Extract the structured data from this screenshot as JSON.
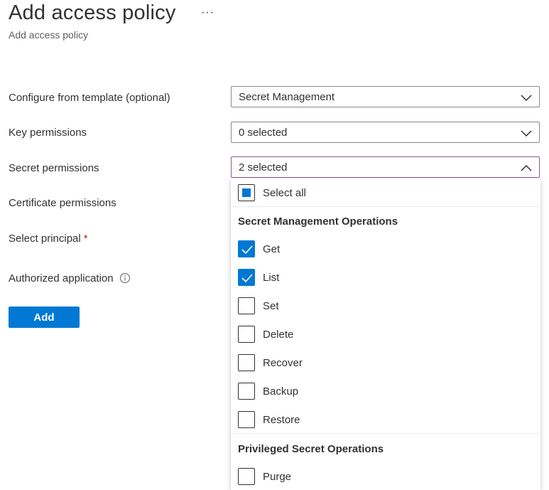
{
  "header": {
    "title": "Add access policy",
    "more_label": "···",
    "subtitle": "Add access policy"
  },
  "form": {
    "template": {
      "label": "Configure from template (optional)",
      "value": "Secret Management"
    },
    "key_permissions": {
      "label": "Key permissions",
      "value": "0 selected"
    },
    "secret_permissions": {
      "label": "Secret permissions",
      "value": "2 selected"
    },
    "certificate_permissions": {
      "label": "Certificate permissions"
    },
    "select_principal": {
      "label": "Select principal",
      "required_marker": "*"
    },
    "authorized_application": {
      "label": "Authorized application"
    },
    "add_button": "Add"
  },
  "dropdown": {
    "select_all": {
      "label": "Select all",
      "state": "indeterminate"
    },
    "groups": [
      {
        "header": "Secret Management Operations",
        "options": [
          {
            "label": "Get",
            "checked": true
          },
          {
            "label": "List",
            "checked": true
          },
          {
            "label": "Set",
            "checked": false
          },
          {
            "label": "Delete",
            "checked": false
          },
          {
            "label": "Recover",
            "checked": false
          },
          {
            "label": "Backup",
            "checked": false
          },
          {
            "label": "Restore",
            "checked": false
          }
        ]
      },
      {
        "header": "Privileged Secret Operations",
        "options": [
          {
            "label": "Purge",
            "checked": false
          }
        ]
      }
    ]
  },
  "colors": {
    "accent": "#0078d4",
    "open_border": "#8a5c8f",
    "required": "#a4262c"
  }
}
